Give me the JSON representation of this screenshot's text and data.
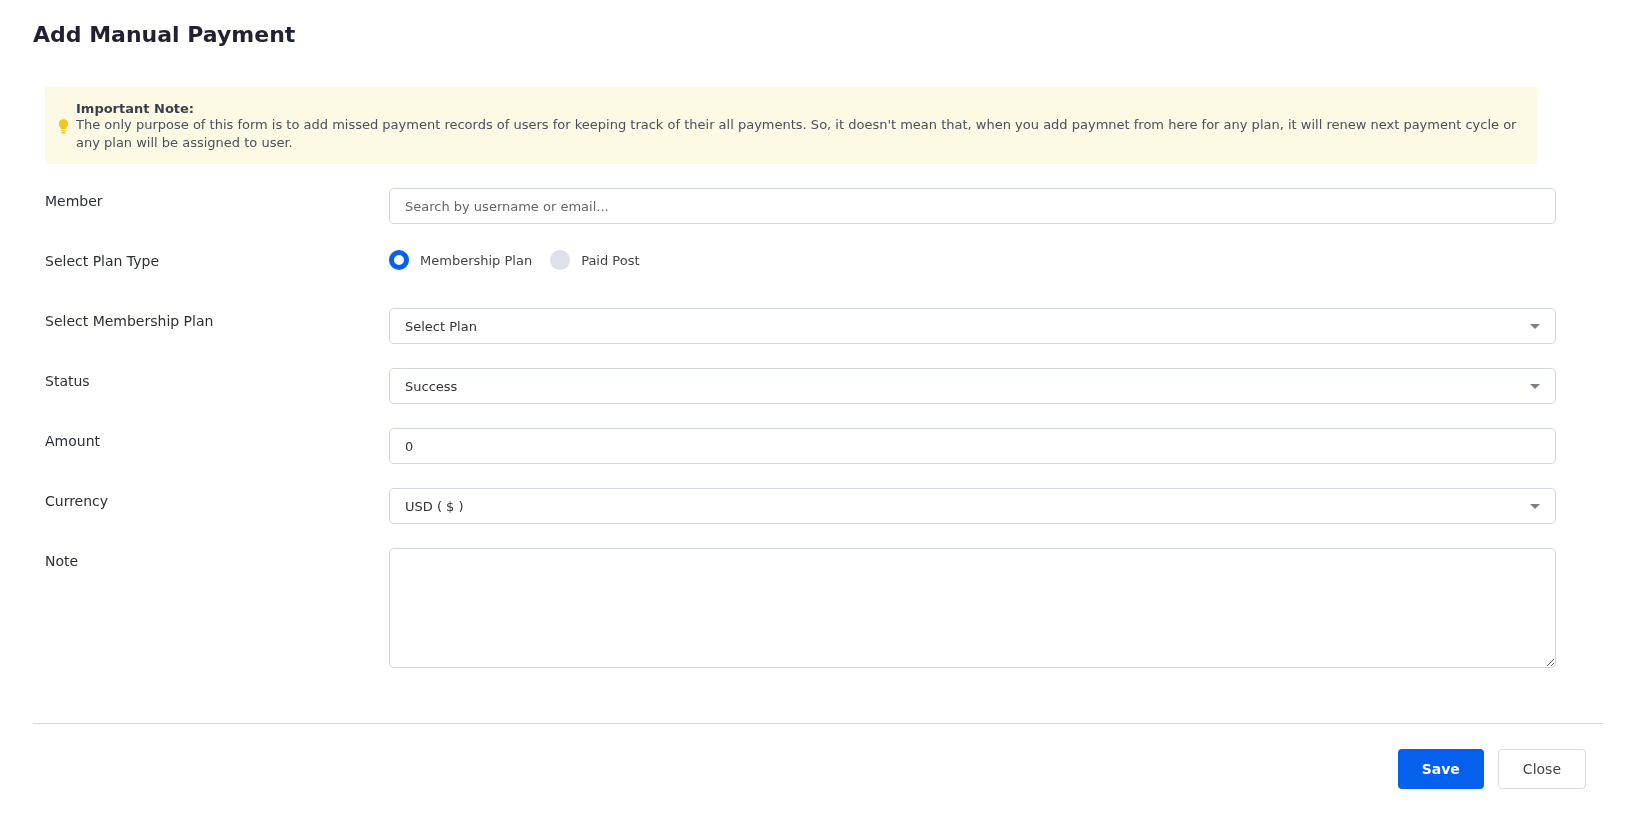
{
  "title": "Add Manual Payment",
  "note": {
    "heading": "Important Note:",
    "text": "The only purpose of this form is to add missed payment records of users for keeping track of their all payments. So, it doesn't mean that, when you add paymnet from here for any plan, it will renew next payment cycle or any plan will be assigned to user."
  },
  "fields": [
    {
      "kind": "text",
      "label": "Member",
      "placeholder": "Search by username or email..."
    },
    {
      "kind": "radio",
      "label": "Select Plan Type",
      "options": [
        {
          "label": "Membership Plan",
          "selected": true
        },
        {
          "label": "Paid Post",
          "selected": false
        }
      ]
    },
    {
      "kind": "select",
      "label": "Select Membership Plan",
      "value": "Select Plan"
    },
    {
      "kind": "select",
      "label": "Status",
      "value": "Success"
    },
    {
      "kind": "text",
      "label": "Amount",
      "value": "0"
    },
    {
      "kind": "select",
      "label": "Currency",
      "value": "USD ( $ )"
    },
    {
      "kind": "textarea",
      "label": "Note"
    }
  ],
  "buttons": [
    {
      "label": "Save",
      "kind": "primary"
    },
    {
      "label": "Close",
      "kind": "secondary"
    }
  ]
}
